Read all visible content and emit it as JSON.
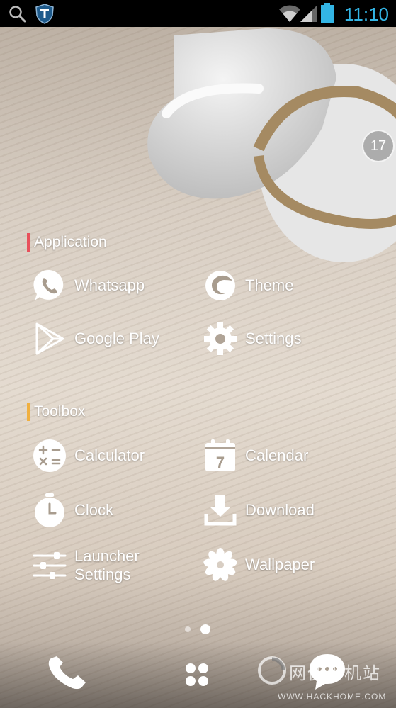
{
  "status_bar": {
    "time": "11:10",
    "icons": [
      "search-icon",
      "shield-icon",
      "wifi-icon",
      "signal-icon",
      "battery-icon"
    ],
    "accent_color": "#33b5e5"
  },
  "notification_badge": {
    "count": "17"
  },
  "sections": [
    {
      "title": "Application",
      "accent_color": "#e8505b",
      "apps": [
        {
          "label": "Whatsapp",
          "icon": "whatsapp-icon"
        },
        {
          "label": "Theme",
          "icon": "theme-icon"
        },
        {
          "label": "Google Play",
          "icon": "google-play-icon"
        },
        {
          "label": "Settings",
          "icon": "gear-icon"
        }
      ]
    },
    {
      "title": "Toolbox",
      "accent_color": "#f0b040",
      "apps": [
        {
          "label": "Calculator",
          "icon": "calculator-icon"
        },
        {
          "label": "Calendar",
          "icon": "calendar-icon",
          "icon_text": "7"
        },
        {
          "label": "Clock",
          "icon": "clock-icon"
        },
        {
          "label": "Download",
          "icon": "download-icon"
        },
        {
          "label": "Launcher Settings",
          "icon": "sliders-icon"
        },
        {
          "label": "Wallpaper",
          "icon": "flower-icon"
        }
      ]
    }
  ],
  "page_indicator": {
    "pages": 2,
    "current": 2
  },
  "dock": {
    "items": [
      "phone-icon",
      "app-drawer-icon",
      "message-icon"
    ]
  },
  "watermark": {
    "text": "网侠手机站",
    "url": "WWW.HACKHOME.COM"
  }
}
